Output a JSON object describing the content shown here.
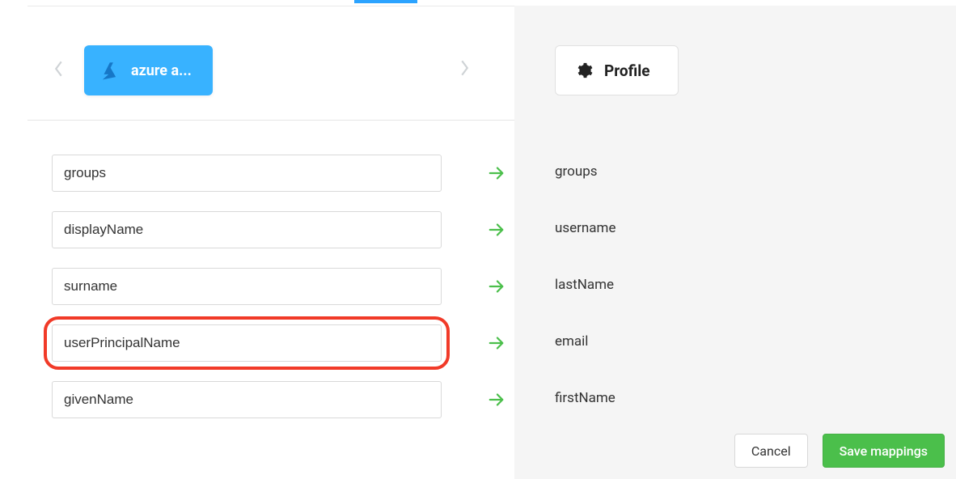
{
  "source": {
    "label": "azure a..."
  },
  "target": {
    "chip_label": "Profile"
  },
  "mappings": [
    {
      "source": "groups",
      "target": "groups",
      "highlight": false
    },
    {
      "source": "displayName",
      "target": "username",
      "highlight": false
    },
    {
      "source": "surname",
      "target": "lastName",
      "highlight": false
    },
    {
      "source": "userPrincipalName",
      "target": "email",
      "highlight": true
    },
    {
      "source": "givenName",
      "target": "firstName",
      "highlight": false
    }
  ],
  "footer": {
    "cancel_label": "Cancel",
    "save_label": "Save mappings"
  }
}
